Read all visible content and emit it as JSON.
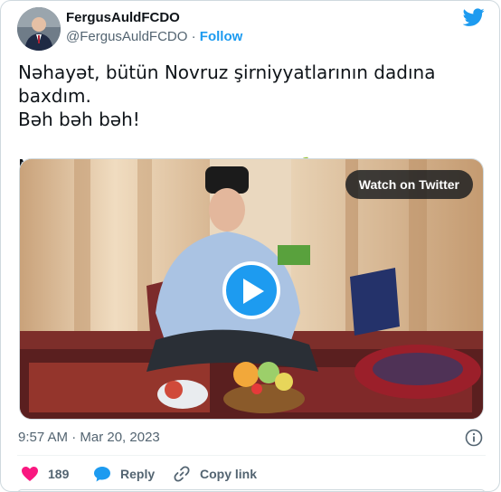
{
  "author": {
    "name": "FergusAuldFCDO",
    "handle": "@FergusAuldFCDO",
    "separator": "·",
    "follow_label": "Follow"
  },
  "tweet": {
    "line1": "Nəhayət, bütün Novruz şirniyyatlarının dadına baxdım.",
    "line2": "Bəh bəh bəh!",
    "line3": "Novruz bayramınız mübarək! 🌱"
  },
  "media": {
    "watch_label": "Watch on Twitter"
  },
  "meta": {
    "timestamp": "9:57 AM · Mar 20, 2023"
  },
  "actions": {
    "like_count": "189",
    "reply_label": "Reply",
    "copy_label": "Copy link"
  },
  "colors": {
    "accent": "#1d9bf0",
    "like": "#f91880",
    "secondary_text": "#536471"
  },
  "icons": [
    "twitter-bird-icon",
    "play-icon",
    "info-icon",
    "heart-icon",
    "reply-bubble-icon",
    "link-icon"
  ]
}
